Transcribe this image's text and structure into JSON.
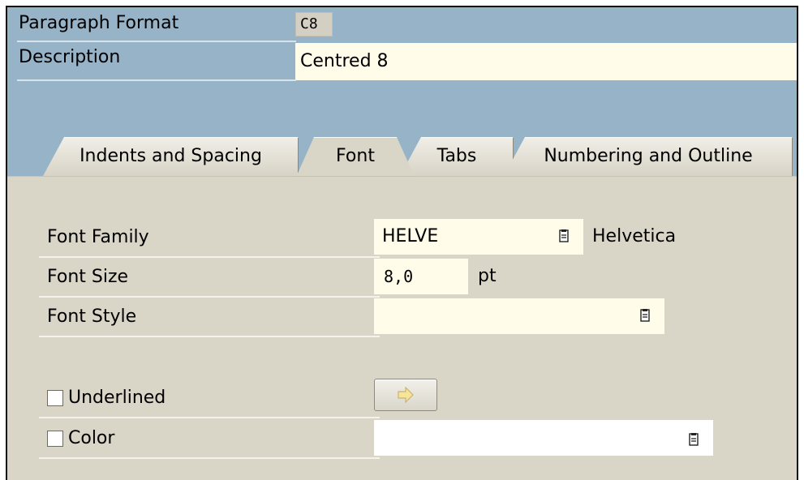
{
  "header": {
    "paragraph_format_label": "Paragraph Format",
    "paragraph_format_value": "C8",
    "description_label": "Description",
    "description_value": "Centred 8"
  },
  "tabs": [
    {
      "label": "Indents and Spacing",
      "active": false
    },
    {
      "label": "Font",
      "active": true
    },
    {
      "label": "Tabs",
      "active": false
    },
    {
      "label": "Numbering and Outline",
      "active": false
    }
  ],
  "font_tab": {
    "font_family_label": "Font Family",
    "font_family_value": "HELVE",
    "font_family_name": "Helvetica",
    "font_size_label": "Font Size",
    "font_size_value": "8,0",
    "font_size_unit": "pt",
    "font_style_label": "Font Style",
    "font_style_value": "",
    "underlined_label": "Underlined",
    "underlined_checked": false,
    "color_label": "Color",
    "color_checked": false,
    "color_value": ""
  },
  "icons": {
    "value_help": "value-help-icon",
    "arrow": "right-arrow-icon"
  },
  "colors": {
    "header_bg": "#97b3c7",
    "panel_bg": "#d9d5c7",
    "input_bg": "#fffde9"
  }
}
